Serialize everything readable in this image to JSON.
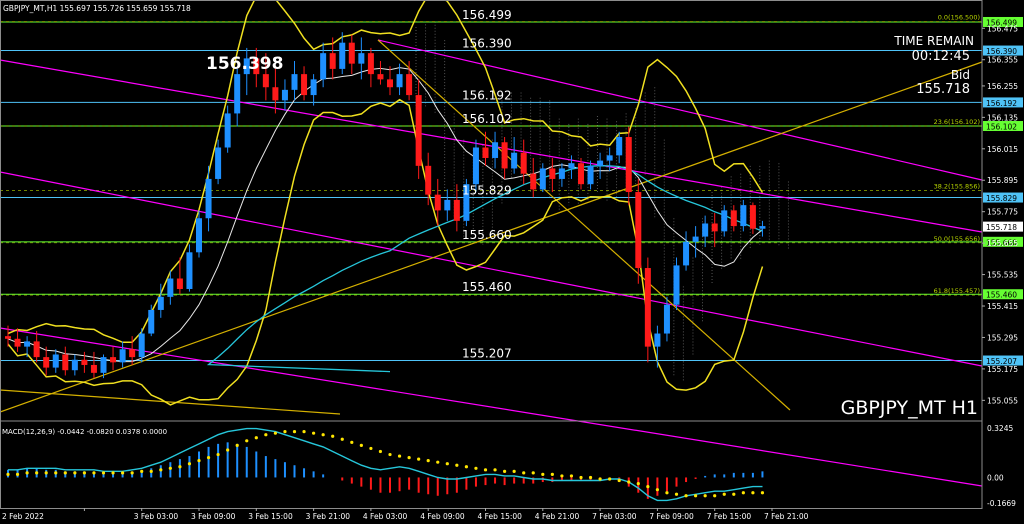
{
  "header": {
    "symbol_info": "GBPJPY_MT,H1  155.697 155.726 155.659 155.718",
    "macd_info": "MACD(12,26,9) -0.0442 -0.0820 0.0378 0.0000"
  },
  "overlay": {
    "high_label": "156.398",
    "time_remain_label": "TIME REMAIN",
    "time_remain_value": "00:12:45",
    "bid_label": "Bid",
    "bid_value": "155.718",
    "watermark": "GBPJPY_MT H1"
  },
  "colors": {
    "background": "#000000",
    "bull_candle": "#1e90ff",
    "bear_candle": "#ff1a1a",
    "level_line": "#66ff33",
    "level_line_cyan": "#4fc3f7",
    "bollinger": "#f0e020",
    "trend_magenta": "#ff00ff",
    "trend_orange": "#d4b000",
    "ma_cyan": "#26c6da",
    "macd_signal": "#ffe600"
  },
  "chart_data": {
    "type": "candlestick",
    "y_range": [
      154.98,
      156.56
    ],
    "levels": [
      {
        "value": 156.499,
        "label": "156.499",
        "axis_label": "156.499",
        "color": "#66ff33"
      },
      {
        "value": 156.39,
        "label": "156.390",
        "axis_label": "156.390",
        "color": "#4fc3f7"
      },
      {
        "value": 156.192,
        "label": "156.192",
        "axis_label": "156.192",
        "color": "#4fc3f7"
      },
      {
        "value": 156.102,
        "label": "156.102",
        "axis_label": "156.102",
        "color": "#66ff33"
      },
      {
        "value": 155.829,
        "label": "155.829",
        "axis_label": "155.829",
        "color": "#4fc3f7"
      },
      {
        "value": 155.66,
        "label": "155.660",
        "axis_label": "155.660",
        "color": "#66ff33"
      },
      {
        "value": 155.46,
        "label": "155.460",
        "axis_label": "155.460",
        "color": "#66ff33"
      },
      {
        "value": 155.207,
        "label": "155.207",
        "axis_label": "155.207",
        "color": "#4fc3f7"
      }
    ],
    "fib_levels": [
      {
        "value": 156.5,
        "label": "0.0(156.500)"
      },
      {
        "value": 156.102,
        "label": "23.6(156.102)"
      },
      {
        "value": 155.856,
        "label": "38.2(155.856)"
      },
      {
        "value": 155.656,
        "label": "50.0(155.656)"
      },
      {
        "value": 155.457,
        "label": "61.8(155.457)"
      }
    ],
    "price_axis_ticks": [
      "156.475",
      "156.355",
      "156.255",
      "156.135",
      "156.015",
      "155.895",
      "155.775",
      "155.655",
      "155.535",
      "155.415",
      "155.295",
      "155.175",
      "155.055"
    ],
    "price_axis_tick_values": [
      156.475,
      156.355,
      156.255,
      156.135,
      156.015,
      155.895,
      155.775,
      155.655,
      155.535,
      155.415,
      155.295,
      155.175,
      155.055
    ],
    "current_price": {
      "value": 155.718,
      "label": "155.718"
    },
    "time_axis_labels": [
      "2 Feb 2022",
      "3 Feb 03:00",
      "3 Feb 09:00",
      "3 Feb 15:00",
      "3 Feb 21:00",
      "4 Feb 03:00",
      "4 Feb 09:00",
      "4 Feb 15:00",
      "4 Feb 21:00",
      "7 Feb 03:00",
      "7 Feb 09:00",
      "7 Feb 15:00",
      "7 Feb 21:00"
    ],
    "time_axis_positions": [
      8,
      14,
      20,
      26,
      32,
      38,
      44,
      50,
      56,
      62,
      68,
      74,
      80
    ],
    "candles": [
      [
        155.3,
        155.34,
        155.26,
        155.29
      ],
      [
        155.29,
        155.33,
        155.24,
        155.26
      ],
      [
        155.26,
        155.3,
        155.22,
        155.28
      ],
      [
        155.28,
        155.32,
        155.2,
        155.22
      ],
      [
        155.22,
        155.26,
        155.15,
        155.18
      ],
      [
        155.18,
        155.25,
        155.16,
        155.23
      ],
      [
        155.23,
        155.26,
        155.15,
        155.17
      ],
      [
        155.17,
        155.23,
        155.15,
        155.21
      ],
      [
        155.21,
        155.24,
        155.16,
        155.19
      ],
      [
        155.19,
        155.24,
        155.14,
        155.16
      ],
      [
        155.16,
        155.23,
        155.14,
        155.22
      ],
      [
        155.22,
        155.26,
        155.17,
        155.2
      ],
      [
        155.2,
        155.28,
        155.18,
        155.25
      ],
      [
        155.25,
        155.3,
        155.19,
        155.22
      ],
      [
        155.22,
        155.33,
        155.2,
        155.31
      ],
      [
        155.31,
        155.42,
        155.3,
        155.4
      ],
      [
        155.4,
        155.5,
        155.37,
        155.45
      ],
      [
        155.45,
        155.55,
        155.42,
        155.52
      ],
      [
        155.52,
        155.6,
        155.46,
        155.48
      ],
      [
        155.48,
        155.65,
        155.47,
        155.62
      ],
      [
        155.62,
        155.78,
        155.6,
        155.75
      ],
      [
        155.75,
        155.95,
        155.7,
        155.9
      ],
      [
        155.9,
        156.05,
        155.88,
        156.02
      ],
      [
        156.02,
        156.18,
        156.0,
        156.15
      ],
      [
        156.15,
        156.32,
        156.1,
        156.3
      ],
      [
        156.3,
        156.4,
        156.22,
        156.36
      ],
      [
        156.36,
        156.4,
        156.25,
        156.3
      ],
      [
        156.3,
        156.38,
        156.2,
        156.25
      ],
      [
        156.25,
        156.32,
        156.15,
        156.2
      ],
      [
        156.2,
        156.28,
        156.16,
        156.24
      ],
      [
        156.24,
        156.35,
        156.2,
        156.3
      ],
      [
        156.3,
        156.33,
        156.2,
        156.22
      ],
      [
        156.22,
        156.3,
        156.18,
        156.28
      ],
      [
        156.28,
        156.42,
        156.25,
        156.38
      ],
      [
        156.38,
        156.44,
        156.28,
        156.32
      ],
      [
        156.32,
        156.46,
        156.3,
        156.42
      ],
      [
        156.42,
        156.45,
        156.3,
        156.34
      ],
      [
        156.34,
        156.44,
        156.28,
        156.38
      ],
      [
        156.38,
        156.4,
        156.25,
        156.3
      ],
      [
        156.3,
        156.35,
        156.26,
        156.28
      ],
      [
        156.28,
        156.33,
        156.22,
        156.25
      ],
      [
        156.25,
        156.34,
        156.22,
        156.3
      ],
      [
        156.3,
        156.35,
        156.2,
        156.22
      ],
      [
        156.22,
        156.28,
        155.9,
        155.95
      ],
      [
        155.95,
        156.0,
        155.8,
        155.84
      ],
      [
        155.84,
        155.9,
        155.72,
        155.78
      ],
      [
        155.78,
        155.86,
        155.74,
        155.82
      ],
      [
        155.82,
        155.88,
        155.7,
        155.74
      ],
      [
        155.74,
        155.9,
        155.72,
        155.88
      ],
      [
        155.88,
        156.05,
        155.85,
        156.02
      ],
      [
        156.02,
        156.08,
        155.95,
        155.98
      ],
      [
        155.98,
        156.08,
        155.94,
        156.04
      ],
      [
        156.04,
        156.06,
        155.9,
        155.94
      ],
      [
        155.94,
        156.06,
        155.92,
        156.0
      ],
      [
        156.0,
        156.05,
        155.88,
        155.92
      ],
      [
        155.92,
        155.98,
        155.83,
        155.86
      ],
      [
        155.86,
        155.96,
        155.85,
        155.94
      ],
      [
        155.94,
        155.98,
        155.85,
        155.9
      ],
      [
        155.9,
        155.96,
        155.87,
        155.94
      ],
      [
        155.94,
        155.99,
        155.9,
        155.96
      ],
      [
        155.96,
        155.98,
        155.86,
        155.88
      ],
      [
        155.88,
        155.97,
        155.86,
        155.95
      ],
      [
        155.95,
        156.0,
        155.9,
        155.97
      ],
      [
        155.97,
        156.02,
        155.93,
        155.99
      ],
      [
        155.99,
        156.08,
        155.96,
        156.06
      ],
      [
        156.06,
        156.1,
        155.8,
        155.85
      ],
      [
        155.85,
        155.9,
        155.5,
        155.56
      ],
      [
        155.56,
        155.6,
        155.2,
        155.26
      ],
      [
        155.26,
        155.34,
        155.18,
        155.31
      ],
      [
        155.31,
        155.45,
        155.28,
        155.42
      ],
      [
        155.42,
        155.6,
        155.4,
        155.57
      ],
      [
        155.57,
        155.7,
        155.55,
        155.66
      ],
      [
        155.66,
        155.72,
        155.6,
        155.68
      ],
      [
        155.68,
        155.76,
        155.64,
        155.73
      ],
      [
        155.73,
        155.77,
        155.64,
        155.7
      ],
      [
        155.7,
        155.8,
        155.68,
        155.78
      ],
      [
        155.78,
        155.8,
        155.7,
        155.72
      ],
      [
        155.72,
        155.82,
        155.7,
        155.8
      ],
      [
        155.8,
        155.81,
        155.69,
        155.71
      ],
      [
        155.71,
        155.74,
        155.68,
        155.72
      ]
    ],
    "macd": {
      "ylim": [
        -0.2,
        0.35
      ],
      "axis_ticks": [
        "0.3245",
        "0.00",
        "-0.1669"
      ],
      "axis_tick_values": [
        0.3245,
        0.0,
        -0.1669
      ],
      "histogram": [
        0.05,
        0.05,
        0.06,
        0.06,
        0.05,
        0.05,
        0.04,
        0.04,
        0.04,
        0.03,
        0.03,
        0.03,
        0.03,
        0.03,
        0.04,
        0.06,
        0.08,
        0.1,
        0.12,
        0.14,
        0.17,
        0.2,
        0.22,
        0.23,
        0.22,
        0.2,
        0.17,
        0.14,
        0.12,
        0.1,
        0.08,
        0.06,
        0.04,
        0.02,
        0.0,
        -0.02,
        -0.04,
        -0.06,
        -0.08,
        -0.1,
        -0.1,
        -0.09,
        -0.08,
        -0.1,
        -0.11,
        -0.12,
        -0.11,
        -0.1,
        -0.08,
        -0.06,
        -0.05,
        -0.04,
        -0.05,
        -0.04,
        -0.04,
        -0.04,
        -0.03,
        -0.03,
        -0.02,
        -0.02,
        -0.02,
        -0.02,
        -0.02,
        -0.02,
        -0.03,
        -0.06,
        -0.1,
        -0.14,
        -0.12,
        -0.09,
        -0.06,
        -0.03,
        -0.01,
        0.01,
        0.02,
        0.02,
        0.03,
        0.03,
        0.03,
        0.04
      ],
      "macd_line": [
        0.05,
        0.05,
        0.06,
        0.06,
        0.06,
        0.06,
        0.05,
        0.05,
        0.05,
        0.05,
        0.04,
        0.04,
        0.04,
        0.05,
        0.06,
        0.08,
        0.1,
        0.13,
        0.16,
        0.19,
        0.22,
        0.25,
        0.28,
        0.3,
        0.31,
        0.32,
        0.32,
        0.31,
        0.3,
        0.28,
        0.26,
        0.24,
        0.22,
        0.2,
        0.17,
        0.14,
        0.11,
        0.08,
        0.06,
        0.05,
        0.06,
        0.07,
        0.06,
        0.04,
        0.02,
        0.0,
        -0.01,
        -0.01,
        0.0,
        0.01,
        0.02,
        0.02,
        0.01,
        0.01,
        0.0,
        -0.01,
        -0.01,
        -0.02,
        -0.02,
        -0.02,
        -0.02,
        -0.02,
        -0.02,
        -0.01,
        -0.01,
        -0.03,
        -0.07,
        -0.12,
        -0.15,
        -0.15,
        -0.14,
        -0.12,
        -0.11,
        -0.1,
        -0.09,
        -0.09,
        -0.08,
        -0.07,
        -0.06,
        -0.06
      ],
      "signal_line": [
        0.02,
        0.02,
        0.03,
        0.03,
        0.03,
        0.03,
        0.03,
        0.03,
        0.03,
        0.03,
        0.03,
        0.03,
        0.03,
        0.03,
        0.04,
        0.04,
        0.05,
        0.06,
        0.07,
        0.09,
        0.11,
        0.13,
        0.15,
        0.18,
        0.21,
        0.24,
        0.26,
        0.28,
        0.29,
        0.3,
        0.3,
        0.3,
        0.29,
        0.28,
        0.27,
        0.25,
        0.23,
        0.21,
        0.19,
        0.17,
        0.15,
        0.14,
        0.13,
        0.12,
        0.11,
        0.1,
        0.09,
        0.08,
        0.07,
        0.06,
        0.05,
        0.05,
        0.04,
        0.04,
        0.03,
        0.03,
        0.02,
        0.02,
        0.01,
        0.01,
        0.0,
        0.0,
        -0.01,
        -0.01,
        -0.02,
        -0.03,
        -0.04,
        -0.06,
        -0.08,
        -0.1,
        -0.11,
        -0.12,
        -0.12,
        -0.12,
        -0.12,
        -0.11,
        -0.11,
        -0.1,
        -0.1,
        -0.1
      ]
    }
  }
}
